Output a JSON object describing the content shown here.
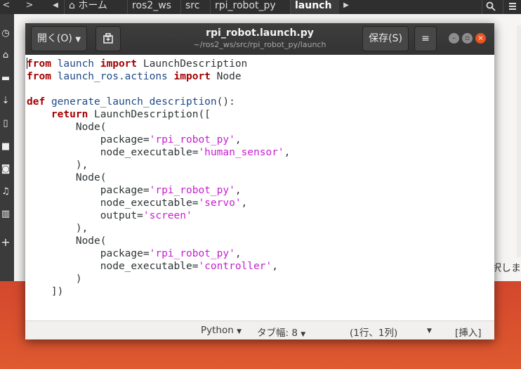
{
  "file_manager": {
    "nav": {
      "back": "<",
      "forward": ">",
      "left_arrow": "◀",
      "right_arrow": "▶"
    },
    "breadcrumbs": [
      "ホーム",
      "ros2_ws",
      "src",
      "rpi_robot_py",
      "launch"
    ],
    "search_icon": "search-icon",
    "partial_text": "択しま"
  },
  "gedit": {
    "open_label": "開く(O)",
    "title": "rpi_robot.launch.py",
    "path": "~/ros2_ws/src/rpi_robot_py/launch",
    "save_label": "保存(S)",
    "menu_label": "≡",
    "code_lines": [
      [
        {
          "t": "from",
          "c": "kw"
        },
        {
          "t": " launch ",
          "c": "imp"
        },
        {
          "t": "import",
          "c": "kw"
        },
        {
          "t": " LaunchDescription",
          "c": ""
        }
      ],
      [
        {
          "t": "from",
          "c": "kw"
        },
        {
          "t": " launch_ros.actions ",
          "c": "imp"
        },
        {
          "t": "import",
          "c": "kw"
        },
        {
          "t": " Node",
          "c": ""
        }
      ],
      [],
      [
        {
          "t": "def",
          "c": "kw"
        },
        {
          "t": " ",
          "c": ""
        },
        {
          "t": "generate_launch_description",
          "c": "fn"
        },
        {
          "t": "():",
          "c": ""
        }
      ],
      [
        {
          "t": "    ",
          "c": ""
        },
        {
          "t": "return",
          "c": "kw"
        },
        {
          "t": " LaunchDescription([",
          "c": ""
        }
      ],
      [
        {
          "t": "        Node(",
          "c": ""
        }
      ],
      [
        {
          "t": "            package=",
          "c": ""
        },
        {
          "t": "'rpi_robot_py'",
          "c": "str"
        },
        {
          "t": ",",
          "c": ""
        }
      ],
      [
        {
          "t": "            node_executable=",
          "c": ""
        },
        {
          "t": "'human_sensor'",
          "c": "str"
        },
        {
          "t": ",",
          "c": ""
        }
      ],
      [
        {
          "t": "        ),",
          "c": ""
        }
      ],
      [
        {
          "t": "        Node(",
          "c": ""
        }
      ],
      [
        {
          "t": "            package=",
          "c": ""
        },
        {
          "t": "'rpi_robot_py'",
          "c": "str"
        },
        {
          "t": ",",
          "c": ""
        }
      ],
      [
        {
          "t": "            node_executable=",
          "c": ""
        },
        {
          "t": "'servo'",
          "c": "str"
        },
        {
          "t": ",",
          "c": ""
        }
      ],
      [
        {
          "t": "            output=",
          "c": ""
        },
        {
          "t": "'screen'",
          "c": "str"
        }
      ],
      [
        {
          "t": "        ),",
          "c": ""
        }
      ],
      [
        {
          "t": "        Node(",
          "c": ""
        }
      ],
      [
        {
          "t": "            package=",
          "c": ""
        },
        {
          "t": "'rpi_robot_py'",
          "c": "str"
        },
        {
          "t": ",",
          "c": ""
        }
      ],
      [
        {
          "t": "            node_executable=",
          "c": ""
        },
        {
          "t": "'controller'",
          "c": "str"
        },
        {
          "t": ",",
          "c": ""
        }
      ],
      [
        {
          "t": "        )",
          "c": ""
        }
      ],
      [
        {
          "t": "    ])",
          "c": ""
        }
      ]
    ],
    "status": {
      "language": "Python",
      "tab_width": "タブ幅: 8",
      "position": "(1行、1列)",
      "mode": "[挿入]"
    }
  }
}
